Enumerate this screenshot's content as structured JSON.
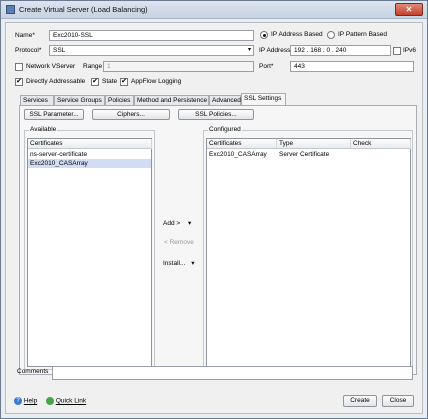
{
  "window": {
    "title": "Create Virtual Server (Load Balancing)",
    "close_glyph": "✕"
  },
  "form": {
    "name_label": "Name*",
    "name_value": "Exc2010-SSL",
    "protocol_label": "Protocol*",
    "protocol_value": "SSL",
    "network_vserver_label": "Network VServer",
    "range_label": "Range",
    "range_value": "1",
    "directly_addressable_label": "Directly Addressable",
    "state_label": "State",
    "appflow_label": "AppFlow Logging",
    "ip_based_label": "IP Address Based",
    "ip_pattern_label": "IP Pattern Based",
    "ip_address_label": "IP Address*",
    "ip_address_value": "192 . 168 . 0  . 240",
    "ipv6_label": "IPv6",
    "port_label": "Port*",
    "port_value": "443",
    "check_glyph": "✔"
  },
  "tabs": [
    {
      "label": "Services"
    },
    {
      "label": "Service Groups"
    },
    {
      "label": "Policies"
    },
    {
      "label": "Method and Persistence"
    },
    {
      "label": "Advanced"
    },
    {
      "label": "SSL Settings"
    }
  ],
  "ssl": {
    "ssl_param_button": "SSL Parameter...",
    "ciphers_button": "Ciphers...",
    "ssl_policies_button": "SSL Policies...",
    "available_title": "Available",
    "configured_title": "Configured",
    "available_header": "Certificates",
    "available_items": [
      "ns-server-certificate",
      "Exc2010_CASArray"
    ],
    "configured_headers": [
      "Certificates",
      "Type",
      "Check"
    ],
    "configured_rows": [
      {
        "certificate": "Exc2010_CASArray",
        "type": "Server Certificate",
        "check": ""
      }
    ],
    "add_button": "Add >",
    "remove_button": "< Remove",
    "install_button": "Install...",
    "dropdown_glyph": "▾"
  },
  "footer": {
    "comments_label": "Comments",
    "comments_value": "",
    "help_label": "Help",
    "quick_link_label": "Quick Link",
    "create_button": "Create",
    "close_button": "Close"
  },
  "colors": {
    "selected_row": "#d2dcf2",
    "title_gradient_top": "#dbe4ef",
    "close_red": "#c4402c"
  }
}
